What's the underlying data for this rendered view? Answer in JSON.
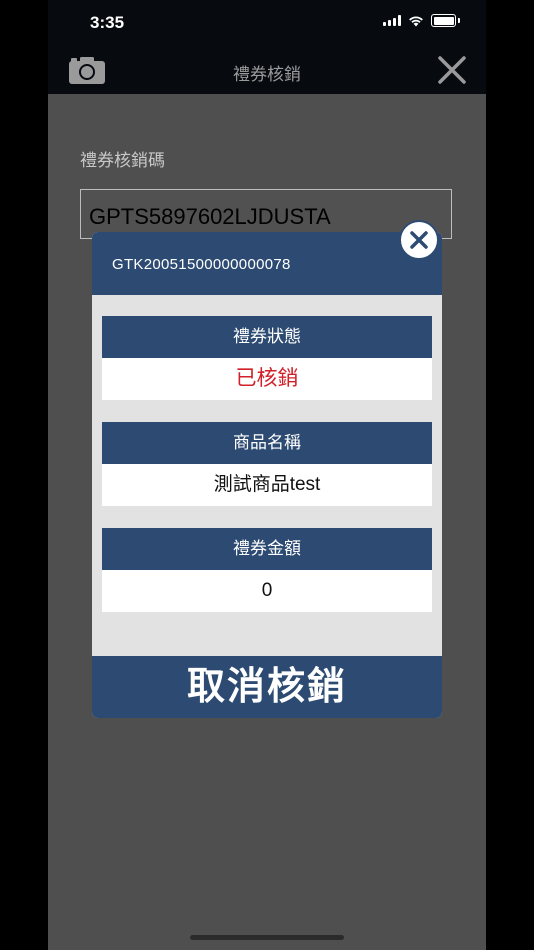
{
  "status_bar": {
    "time": "3:35"
  },
  "nav": {
    "title": "禮券核銷",
    "left_icon": "camera-icon",
    "right_icon": "close-icon"
  },
  "form": {
    "label": "禮券核銷碼",
    "code_value": "GPTS5897602LJDUSTA"
  },
  "modal": {
    "id": "GTK20051500000000078",
    "rows": [
      {
        "label": "禮券狀態",
        "value": "已核銷",
        "value_color": "#d0202a"
      },
      {
        "label": "商品名稱",
        "value": "測試商品test"
      },
      {
        "label": "禮券金額",
        "value": "0"
      }
    ],
    "action_label": "取消核銷"
  },
  "colors": {
    "primary": "#2d4b72",
    "status_red": "#d0202a",
    "overlay": "#4f4f4f"
  }
}
